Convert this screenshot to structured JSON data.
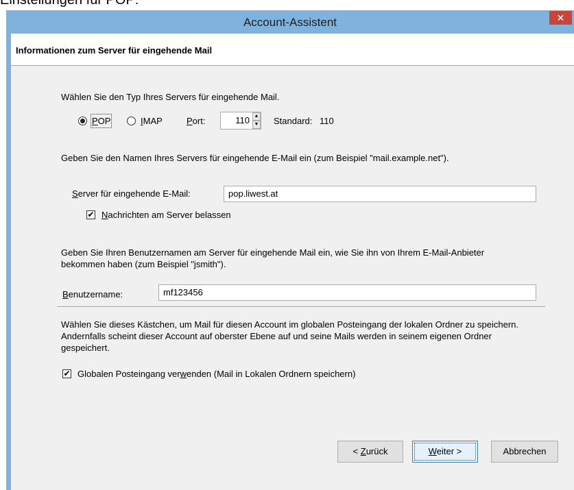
{
  "document": {
    "heading": "Einstellungen für POP:"
  },
  "window": {
    "title": "Account-Assistent",
    "close_glyph": "✕"
  },
  "header": {
    "title": "Informationen zum Server für eingehende Mail"
  },
  "server_type": {
    "prompt": "Wählen Sie den Typ Ihres Servers für eingehende Mail.",
    "pop_label": "POP",
    "imap_label": "IMAP",
    "port_label": "Port:",
    "port_value": "110",
    "standard_label": "Standard:",
    "standard_value": "110",
    "selected": "POP"
  },
  "server_name": {
    "prompt": "Geben Sie den Namen Ihres Servers für eingehende E-Mail ein (zum Beispiel \"mail.example.net\").",
    "label": "Server für eingehende E-Mail:",
    "value": "pop.liwest.at",
    "leave_on_server_label": "Nachrichten am Server belassen",
    "leave_on_server_checked": true
  },
  "username": {
    "prompt": "Geben Sie Ihren Benutzernamen am Server für eingehende Mail ein, wie Sie ihn von Ihrem E-Mail-Anbieter bekommen haben (zum Beispiel \"jsmith\").",
    "label": "Benutzername:",
    "value": "mf123456"
  },
  "global_inbox": {
    "prompt": "Wählen Sie dieses Kästchen, um Mail für diesen Account im globalen Posteingang der lokalen Ordner zu speichern. Andernfalls scheint dieser Account auf oberster Ebene auf und seine Mails werden in seinem eigenen Ordner gespeichert.",
    "label": "Globalen Posteingang verwenden (Mail in Lokalen Ordnern speichern)",
    "checked": true
  },
  "buttons": {
    "back": "< Zurück",
    "next": "Weiter >",
    "cancel": "Abbrechen"
  },
  "glyphs": {
    "check": "✔",
    "spin_up": "▲",
    "spin_down": "▼"
  },
  "colors": {
    "titlebar": "#7fb2dd",
    "close_button": "#c7463a",
    "client": "#f0f0f0"
  }
}
